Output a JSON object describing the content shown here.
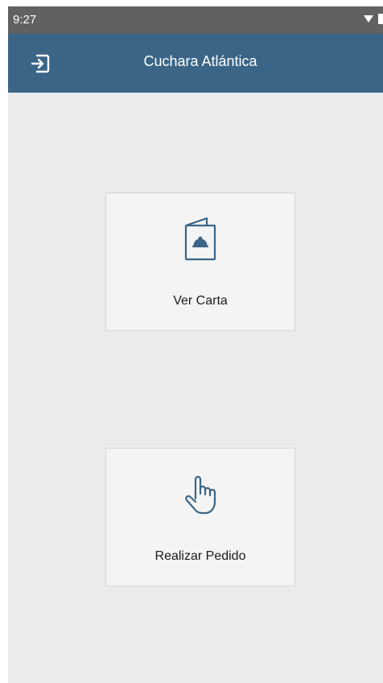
{
  "status_bar": {
    "time": "9:27"
  },
  "app_bar": {
    "title": "Cuchara Atlántica",
    "exit_icon": "exit-icon"
  },
  "options": [
    {
      "label": "Ver Carta",
      "icon": "menu-card-icon"
    },
    {
      "label": "Realizar Pedido",
      "icon": "hand-pointer-icon"
    }
  ],
  "colors": {
    "app_bar": "#3b6586",
    "status_bar": "#5f6163",
    "background": "#ebebeb",
    "card": "#f4f4f4",
    "icon_stroke": "#3b6586"
  }
}
